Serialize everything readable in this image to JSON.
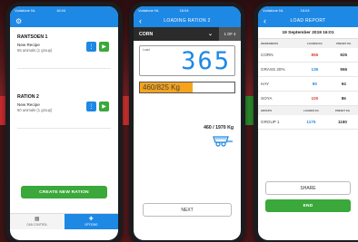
{
  "colors": {
    "accent": "#1e88e5",
    "green": "#3aa83a",
    "red": "#e53935",
    "orange": "#f5a31d"
  },
  "status": {
    "carrier": "Vodafone NL",
    "time": "16:04"
  },
  "screen1": {
    "rations": [
      {
        "name": "RANTSOEN 1",
        "recipe": "New Recipe",
        "animals": "55 animals (1 group)"
      },
      {
        "name": "RATION 2",
        "recipe": "New Recipe",
        "animals": "60 animals (1 group)"
      }
    ],
    "create_label": "CREATE NEW RATION",
    "tabs": [
      {
        "label": "CAB CONTROL",
        "icon": "grid-icon"
      },
      {
        "label": "OPTIONS",
        "icon": "options-icon"
      }
    ]
  },
  "screen2": {
    "title": "LOADING RATION 2",
    "ingredient": "CORN",
    "step": "1 OF 4",
    "load_label": "Load",
    "load_value": "365",
    "progress_text": "460/825 Kg",
    "progress_fraction": 0.56,
    "weight_text": "460 / 1970 Kg",
    "next_label": "NEXT"
  },
  "screen3": {
    "title": "LOAD REPORT",
    "date": "19 September 2019 16:01",
    "ingredient_headers": [
      "INGREDIENTS",
      "LOADED KG",
      "PRESET KG"
    ],
    "ingredients": [
      {
        "name": "CORN",
        "loaded": "855",
        "preset": "825",
        "color": "#e53935"
      },
      {
        "name": "GRASS 20%",
        "loaded": "135",
        "preset": "966",
        "color": "#1e88e5"
      },
      {
        "name": "HAY",
        "loaded": "90",
        "preset": "94",
        "color": "#1e88e5"
      },
      {
        "name": "SOYA",
        "loaded": "100",
        "preset": "86",
        "color": "#e53935"
      }
    ],
    "group_headers": [
      "GROUPS",
      "LOADED KG",
      "PRESET KG"
    ],
    "groups": [
      {
        "name": "GROUP 1",
        "loaded": "1175",
        "preset": "1180",
        "color": "#1e88e5"
      }
    ],
    "share_label": "SHARE",
    "end_label": "END"
  }
}
